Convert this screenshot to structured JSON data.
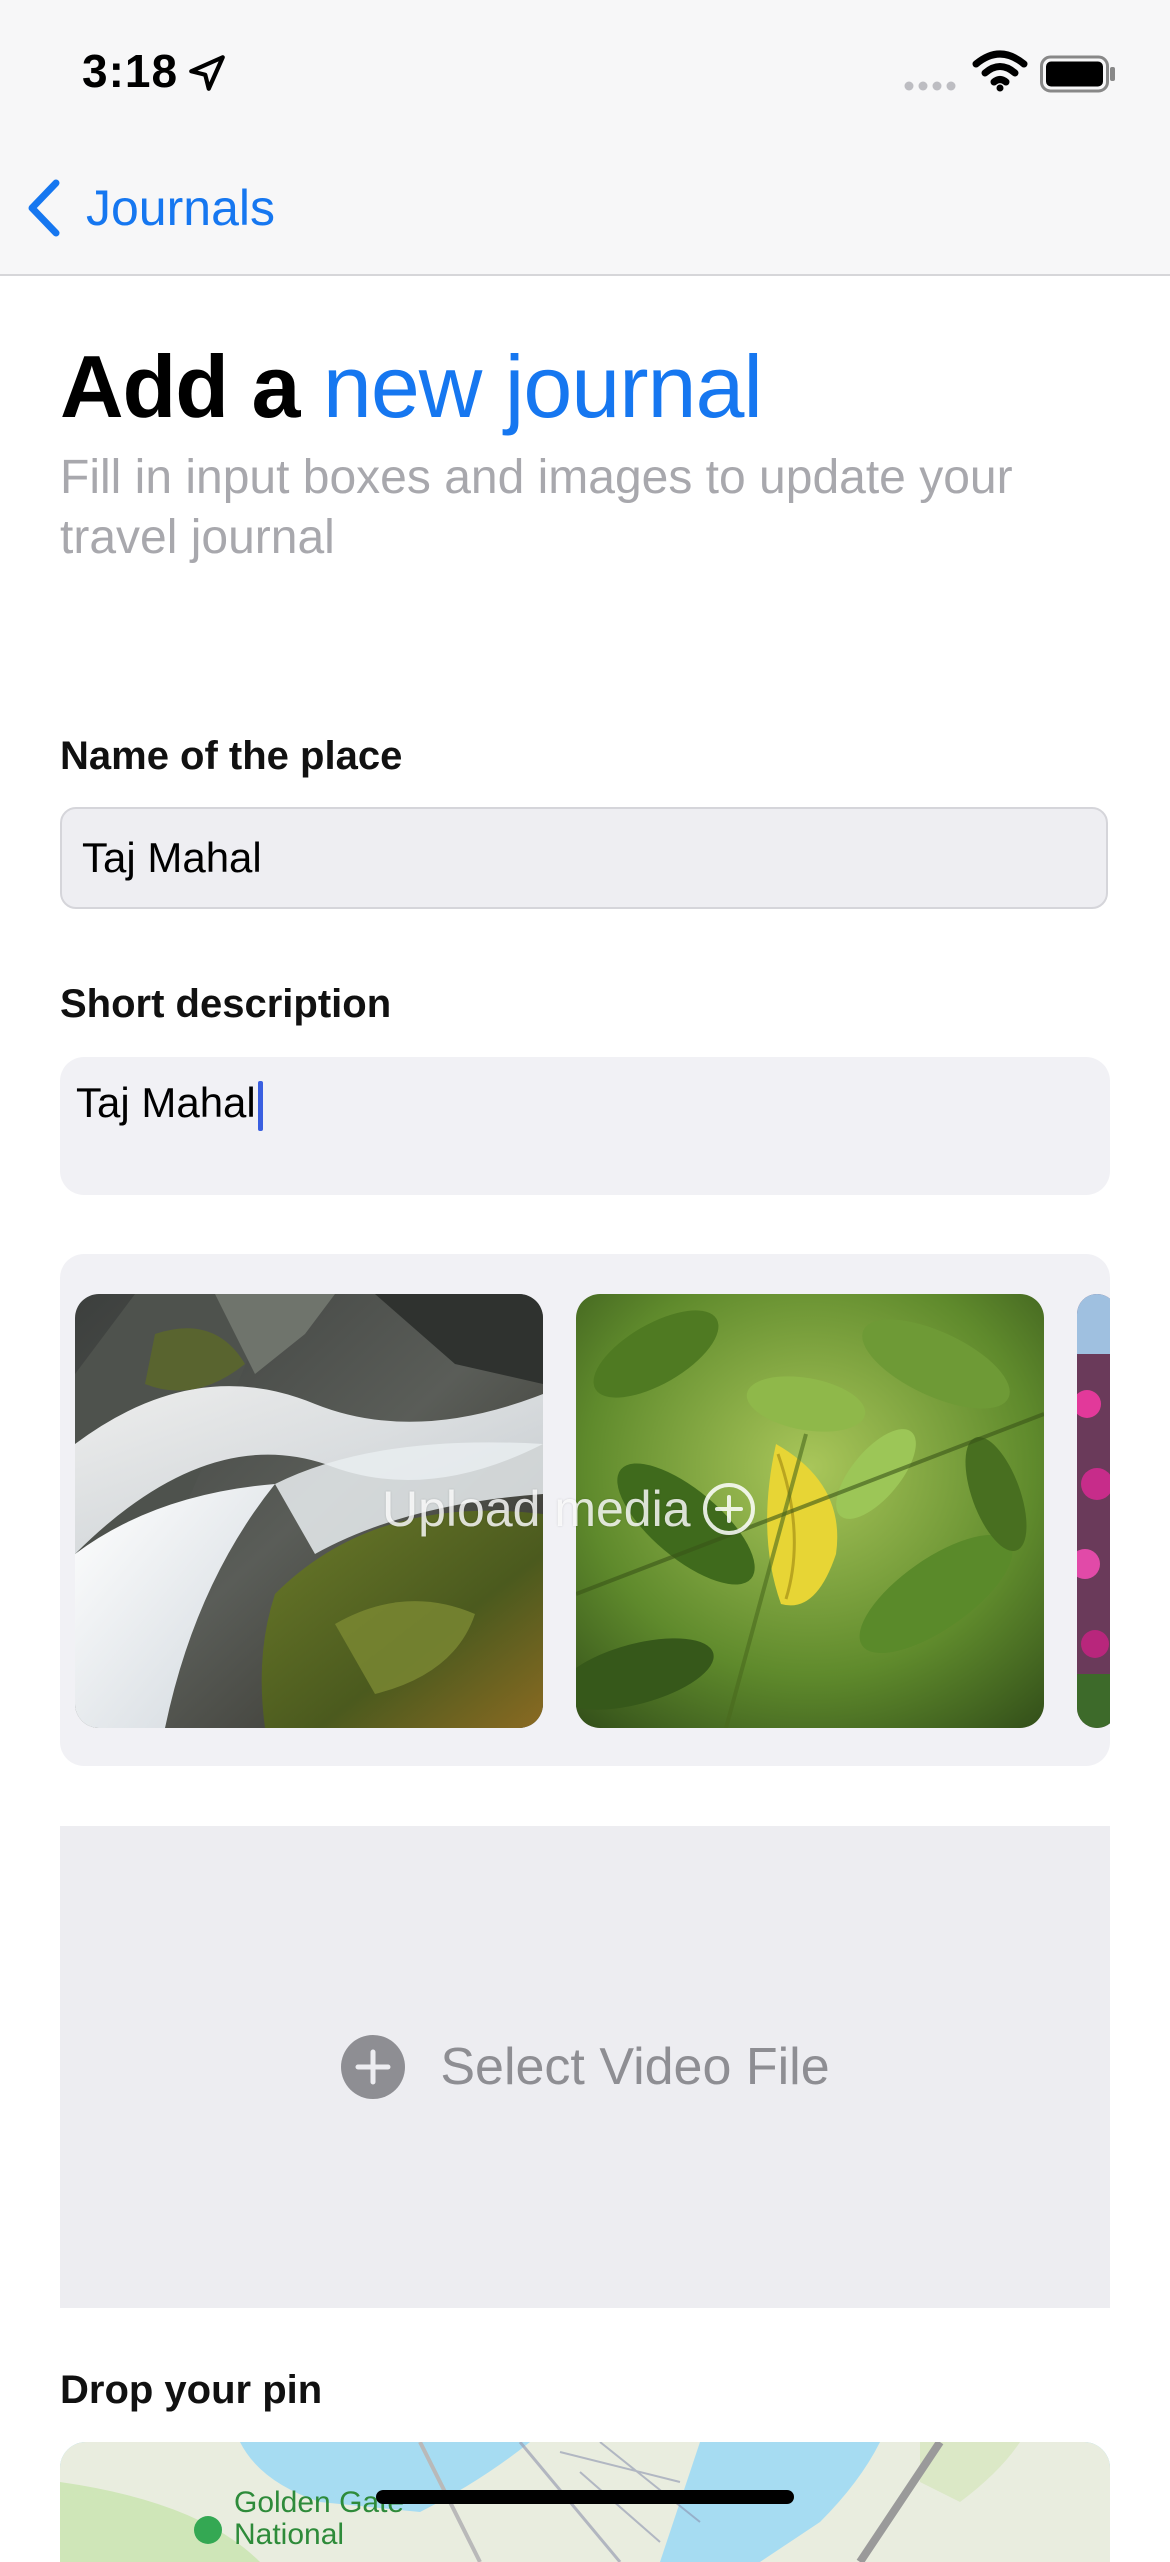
{
  "status_bar": {
    "time": "3:18"
  },
  "nav": {
    "back_label": "Journals"
  },
  "header": {
    "title_plain": "Add a",
    "title_accent": "new journal",
    "subtitle": "Fill in input boxes and images to update your travel journal"
  },
  "form": {
    "place_label": "Name of the place",
    "place_value": "Taj Mahal",
    "description_label": "Short description",
    "description_value": "Taj Mahal"
  },
  "media": {
    "upload_label": "Upload media",
    "thumbnails": [
      "waterfall-photo",
      "green-leaves-photo",
      "pink-flowers-photo"
    ]
  },
  "video": {
    "select_label": "Select Video File"
  },
  "map": {
    "section_label": "Drop your pin",
    "place_label_line1": "Golden Gate",
    "place_label_line2": "National"
  },
  "colors": {
    "accent": "#1677f0",
    "field_bg": "#eeeef2",
    "muted_text": "#a8a8ad"
  }
}
